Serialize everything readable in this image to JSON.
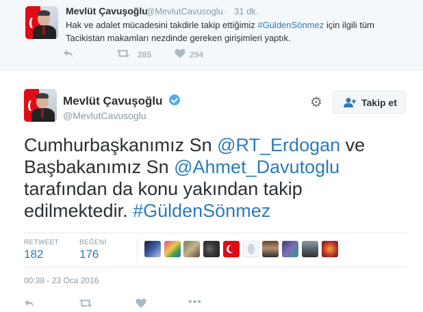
{
  "prev_tweet": {
    "name": "Mevlüt Çavuşoğlu",
    "handle": "@MevlutCavusoglu",
    "separator": "·",
    "time": "31 dk.",
    "text_before": "Hak ve adalet mücadesini takdirle takip ettiğimiz ",
    "hashtag": "#GüldenSönmez",
    "text_after": " için ilgili tüm Tacikistan makamları nezdinde gereken girişimleri yaptık.",
    "retweet_count": "285",
    "like_count": "294"
  },
  "tweet": {
    "name": "Mevlüt Çavuşoğlu",
    "handle": "@MevlutCavusoglu",
    "follow_label": "Takip et",
    "text_1": "Cumhurbaşkanımız Sn ",
    "mention_1": "@RT_Erdogan",
    "text_2": " ve Başbakanımız Sn ",
    "mention_2": "@Ahmet_Davutoglu",
    "text_3": " tarafından da konu yakından takip edilmektedir. ",
    "hashtag": "#GüldenSönmez",
    "retweet_label": "RETWEET",
    "retweet_count": "182",
    "like_label": "BEĞENİ",
    "like_count": "176",
    "date": "00:38 - 23 Oca 2016"
  },
  "colors": {
    "link": "#2b7bb9",
    "verified": "#55acee",
    "muted": "#8899a6",
    "action_icon": "#aab8c2"
  },
  "icons": [
    "reply-icon",
    "retweet-icon",
    "like-icon",
    "gear-icon",
    "follow-person-icon",
    "verified-badge-icon"
  ]
}
